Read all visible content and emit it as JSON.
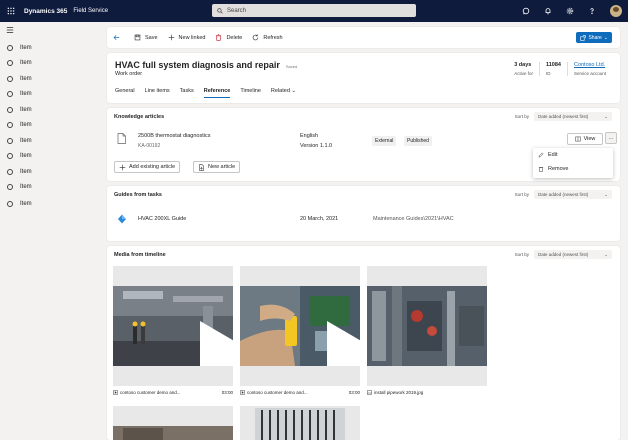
{
  "topbar": {
    "app_name": "Dynamics 365",
    "module": "Field Service",
    "search_placeholder": "Search"
  },
  "sidebar": {
    "items": [
      {
        "label": "Item"
      },
      {
        "label": "Item"
      },
      {
        "label": "Item"
      },
      {
        "label": "Item"
      },
      {
        "label": "Item"
      },
      {
        "label": "Item"
      },
      {
        "label": "Item"
      },
      {
        "label": "Item"
      },
      {
        "label": "Item"
      },
      {
        "label": "Item"
      },
      {
        "label": "Item"
      }
    ]
  },
  "commandbar": {
    "save": "Save",
    "new_linked": "New linked",
    "delete": "Delete",
    "refresh": "Refresh",
    "share": "Share"
  },
  "record": {
    "title": "HVAC full system diagnosis and repair",
    "saved": "Saved",
    "type": "Work order",
    "stats": [
      {
        "value": "3 days",
        "label": "Active for"
      },
      {
        "value": "11084",
        "label": "ID"
      },
      {
        "value": "Contoso Ltd.",
        "label": "Service account"
      }
    ],
    "tabs": [
      "General",
      "Line items",
      "Tasks",
      "Reference",
      "Timeline",
      "Related"
    ]
  },
  "knowledge": {
    "title": "Knowledge articles",
    "sort_label": "Sort by",
    "sort_value": "Date added (newest first)",
    "article": {
      "title": "2500B thermostat diagnostics",
      "id": "KA-00192",
      "language": "English",
      "version": "Version 1.1.0",
      "visibility": "External",
      "status": "Published"
    },
    "view": "View",
    "more": "...",
    "add_existing": "Add existing article",
    "new_article": "New article"
  },
  "context_menu": {
    "edit": "Edit",
    "remove": "Remove"
  },
  "guides": {
    "title": "Guides from tasks",
    "sort_label": "Sort by",
    "sort_value": "Date added (newest first)",
    "item": {
      "title": "HVAC 200XL Guide",
      "date": "20 March, 2021",
      "path": "Maintenance Guides\\2021\\HVAC"
    }
  },
  "media": {
    "title": "Media from timeline",
    "sort_label": "Sort by",
    "sort_value": "Date added (newest first)",
    "items": [
      {
        "name": "contoso customer demo and...",
        "time": "03:00"
      },
      {
        "name": "contoso customer demo and...",
        "time": "03:00"
      },
      {
        "name": "install pipework 2019.jpg",
        "time": ""
      }
    ]
  },
  "colors": {
    "accent": "#0f6cbd",
    "topbar": "#0f1b3d"
  }
}
